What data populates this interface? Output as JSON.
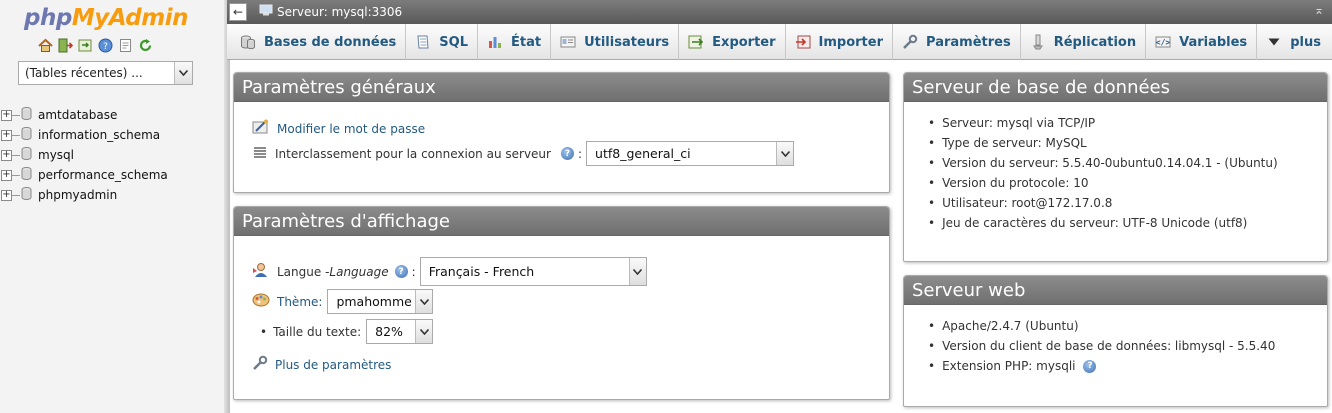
{
  "nav": {
    "logo_php": "php",
    "logo_myadmin": "MyAdmin",
    "icons": [
      "home-icon",
      "exit-icon",
      "query-window-icon",
      "docs-icon",
      "wiki-icon",
      "reload-icon"
    ],
    "recent_tables": "(Tables récentes) ...",
    "databases": [
      "amtdatabase",
      "information_schema",
      "mysql",
      "performance_schema",
      "phpmyadmin"
    ]
  },
  "topbar": {
    "breadcrumb": "Serveur: mysql:3306"
  },
  "tabs": [
    {
      "label": "Bases de données",
      "icon": "databases-icon"
    },
    {
      "label": "SQL",
      "icon": "sql-icon"
    },
    {
      "label": "État",
      "icon": "status-icon"
    },
    {
      "label": "Utilisateurs",
      "icon": "users-icon"
    },
    {
      "label": "Exporter",
      "icon": "export-icon"
    },
    {
      "label": "Importer",
      "icon": "import-icon"
    },
    {
      "label": "Paramètres",
      "icon": "settings-icon"
    },
    {
      "label": "Réplication",
      "icon": "replication-icon"
    },
    {
      "label": "Variables",
      "icon": "variables-icon"
    },
    {
      "label": "plus",
      "icon": "more-icon"
    }
  ],
  "general": {
    "title": "Paramètres généraux",
    "change_password": "Modifier le mot de passe",
    "collation_label": "Interclassement pour la connexion au serveur",
    "collation_value": "utf8_general_ci"
  },
  "display": {
    "title": "Paramètres d'affichage",
    "language_label": "Langue - ",
    "language_label_em": "Language",
    "language_value": "Français - French",
    "theme_label": "Thème:",
    "theme_value": "pmahomme",
    "fontsize_label": "Taille du texte:",
    "fontsize_value": "82%",
    "more_settings": "Plus de paramètres"
  },
  "db_server": {
    "title": "Serveur de base de données",
    "items": [
      "Serveur: mysql via TCP/IP",
      "Type de serveur: MySQL",
      "Version du serveur: 5.5.40-0ubuntu0.14.04.1 - (Ubuntu)",
      "Version du protocole: 10",
      "Utilisateur: root@172.17.0.8",
      "Jeu de caractères du serveur: UTF-8 Unicode (utf8)"
    ]
  },
  "web_server": {
    "title": "Serveur web",
    "items": [
      "Apache/2.4.7 (Ubuntu)",
      "Version du client de base de données: libmysql - 5.5.40",
      "Extension PHP: mysqli"
    ]
  }
}
